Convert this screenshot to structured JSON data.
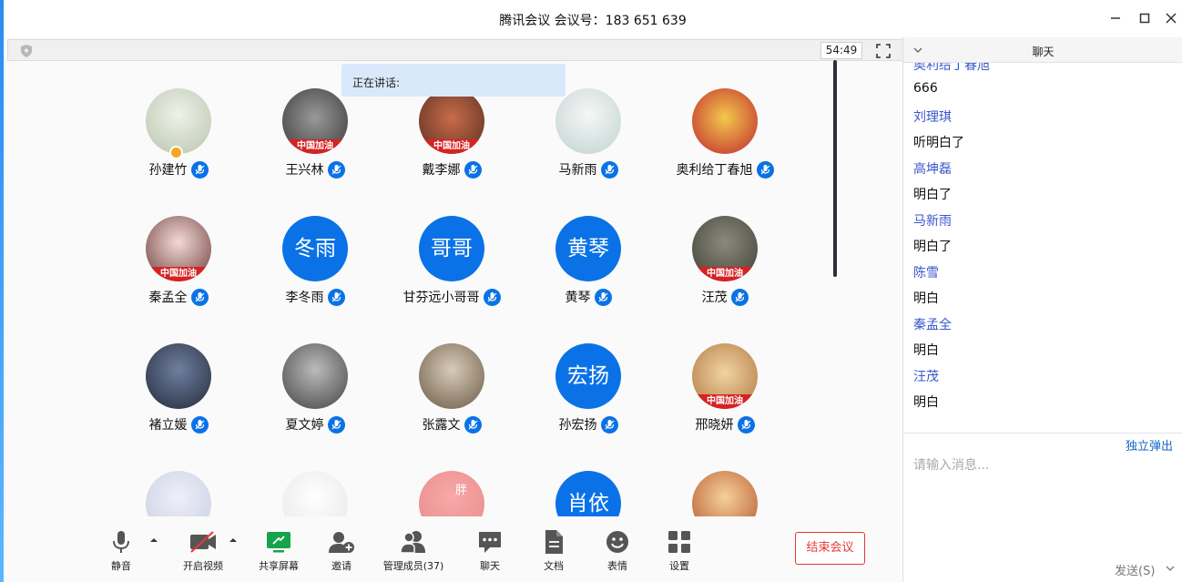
{
  "window": {
    "title": "腾讯会议 会议号：183 651 639"
  },
  "meeting": {
    "timer": "54:49",
    "speaking_label": "正在讲话:"
  },
  "participants": [
    {
      "name": "孙建竹",
      "avatar": "photo",
      "host": true
    },
    {
      "name": "王兴林",
      "avatar": "photo",
      "banner": "中国加油"
    },
    {
      "name": "戴李娜",
      "avatar": "photo",
      "banner": "中国加油"
    },
    {
      "name": "马新雨",
      "avatar": "photo"
    },
    {
      "name": "奥利给丁春旭",
      "avatar": "photo"
    },
    {
      "name": "秦孟全",
      "avatar": "photo",
      "banner": "中国加油"
    },
    {
      "name": "李冬雨",
      "avatar_text": "冬雨"
    },
    {
      "name": "甘芬远小哥哥",
      "avatar_text": "哥哥"
    },
    {
      "name": "黄琴",
      "avatar_text": "黄琴"
    },
    {
      "name": "汪茂",
      "avatar": "photo",
      "banner": "中国加油"
    },
    {
      "name": "褚立媛",
      "avatar": "photo"
    },
    {
      "name": "夏文婷",
      "avatar": "photo"
    },
    {
      "name": "张露文",
      "avatar": "photo"
    },
    {
      "name": "孙宏扬",
      "avatar_text": "宏扬"
    },
    {
      "name": "邢晓妍",
      "avatar": "photo",
      "banner": "中国加油"
    },
    {
      "name": "",
      "avatar": "photo"
    },
    {
      "name": "",
      "avatar": "photo"
    },
    {
      "name": "",
      "avatar": "photo",
      "overlay": "胖"
    },
    {
      "name": "",
      "avatar_text": "肖依"
    },
    {
      "name": "",
      "avatar": "photo"
    }
  ],
  "toolbar": {
    "mute": "静音",
    "video": "开启视频",
    "share": "共享屏幕",
    "invite": "邀请",
    "members": "管理成员(37)",
    "chat": "聊天",
    "docs": "文档",
    "emoji": "表情",
    "settings": "设置",
    "end": "结束会议"
  },
  "chat": {
    "title": "聊天",
    "messages": [
      {
        "sender": "奥利给丁春旭",
        "text": "666"
      },
      {
        "sender": "刘理琪",
        "text": "听明白了"
      },
      {
        "sender": "高坤磊",
        "text": "明白了"
      },
      {
        "sender": "马新雨",
        "text": "明白了"
      },
      {
        "sender": "陈雪",
        "text": "明白"
      },
      {
        "sender": "秦孟全",
        "text": "明白"
      },
      {
        "sender": "汪茂",
        "text": "明白"
      }
    ],
    "popout": "独立弹出",
    "placeholder": "请输入消息...",
    "send": "发送(S)"
  },
  "colors": {
    "accent": "#0a72e6",
    "sender": "#3a57cc",
    "end": "#e53935",
    "speaking_bg": "#d9e8fb"
  }
}
